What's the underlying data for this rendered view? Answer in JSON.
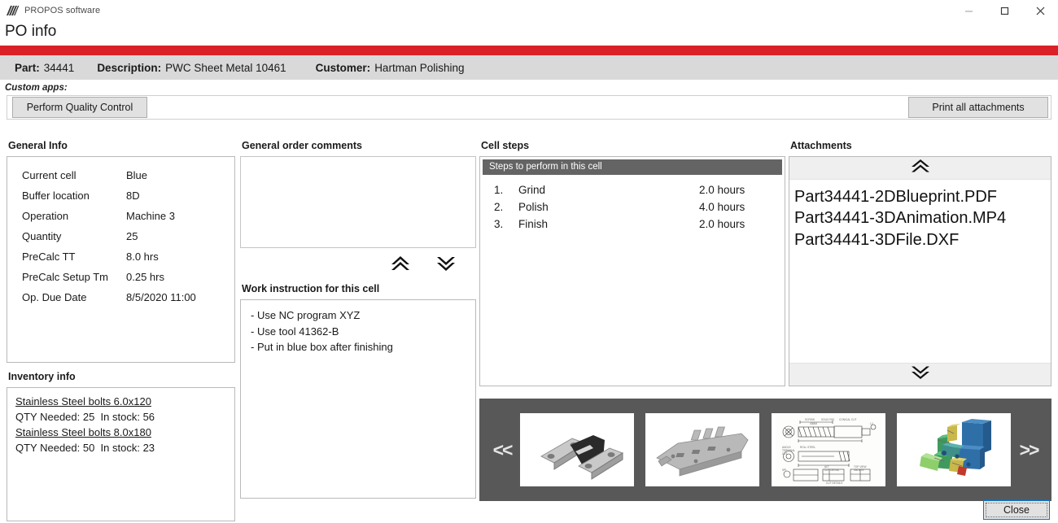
{
  "window": {
    "brand": "PROPOS software",
    "brand_logo_icon": "propos-hatched-logo",
    "title": "PO info",
    "accent_color": "#da2128",
    "controls": [
      {
        "name": "minimize",
        "icon": "minimize-icon"
      },
      {
        "name": "maximize",
        "icon": "maximize-icon"
      },
      {
        "name": "close",
        "icon": "close-icon"
      }
    ]
  },
  "identity": {
    "part_label": "Part:",
    "part_value": "34441",
    "description_label": "Description:",
    "description_value": "PWC Sheet Metal 10461",
    "customer_label": "Customer:",
    "customer_value": "Hartman Polishing"
  },
  "custom_apps": {
    "label": "Custom apps:",
    "perform_quality_control": "Perform Quality Control",
    "print_all_attachments": "Print all attachments"
  },
  "general_info": {
    "title": "General Info",
    "rows": [
      {
        "key": "Current cell",
        "value": "Blue"
      },
      {
        "key": "Buffer location",
        "value": "8D"
      },
      {
        "key": "Operation",
        "value": "Machine 3"
      },
      {
        "key": "Quantity",
        "value": "25"
      },
      {
        "key": "PreCalc TT",
        "value": "8.0 hrs"
      },
      {
        "key": "PreCalc Setup Tm",
        "value": "0.25 hrs"
      },
      {
        "key": "Op. Due Date",
        "value": "8/5/2020  11:00"
      }
    ]
  },
  "inventory_info": {
    "title": "Inventory info",
    "items": [
      {
        "name": "Stainless Steel bolts 6.0x120",
        "detail": "QTY Needed: 25  In stock: 56"
      },
      {
        "name": "Stainless Steel bolts 8.0x180",
        "detail": "QTY Needed: 50  In stock: 23"
      }
    ]
  },
  "general_order_comments": {
    "title": "General order comments",
    "value": "",
    "placeholder": "",
    "scroll_up_icon": "double-chevron-up-icon",
    "scroll_down_icon": "double-chevron-down-icon"
  },
  "work_instruction": {
    "title": "Work instruction for this cell",
    "lines": [
      "- Use NC program XYZ",
      "- Use tool 41362-B",
      "- Put in blue box after finishing"
    ]
  },
  "cell_steps": {
    "title": "Cell steps",
    "header": "Steps to perform in this cell",
    "header_bg": "#646464",
    "steps": [
      {
        "num": "1.",
        "name": "Grind",
        "hours": "2.0 hours"
      },
      {
        "num": "2.",
        "name": "Polish",
        "hours": "4.0 hours"
      },
      {
        "num": "3.",
        "name": "Finish",
        "hours": "2.0 hours"
      }
    ]
  },
  "attachments": {
    "title": "Attachments",
    "scroll_up_icon": "double-chevron-up-icon",
    "scroll_down_icon": "double-chevron-down-icon",
    "files": [
      "Part34441-2DBlueprint.PDF",
      "Part34441-3DAnimation.MP4",
      "Part34441-3DFile.DXF"
    ]
  },
  "carousel": {
    "prev_label": "<<",
    "next_label": ">>",
    "background": "#585858",
    "thumbnails": [
      {
        "name": "thumb-metal-brackets",
        "alt": "photo of black and silver metal brackets"
      },
      {
        "name": "thumb-sheet-metal-frame",
        "alt": "photo of a sheet metal chassis frame"
      },
      {
        "name": "thumb-2d-blueprint",
        "alt": "2D technical blueprint drawing"
      },
      {
        "name": "thumb-3d-model",
        "alt": "colored 3D CAD assembly model"
      }
    ]
  },
  "footer": {
    "close_label": "Close"
  }
}
